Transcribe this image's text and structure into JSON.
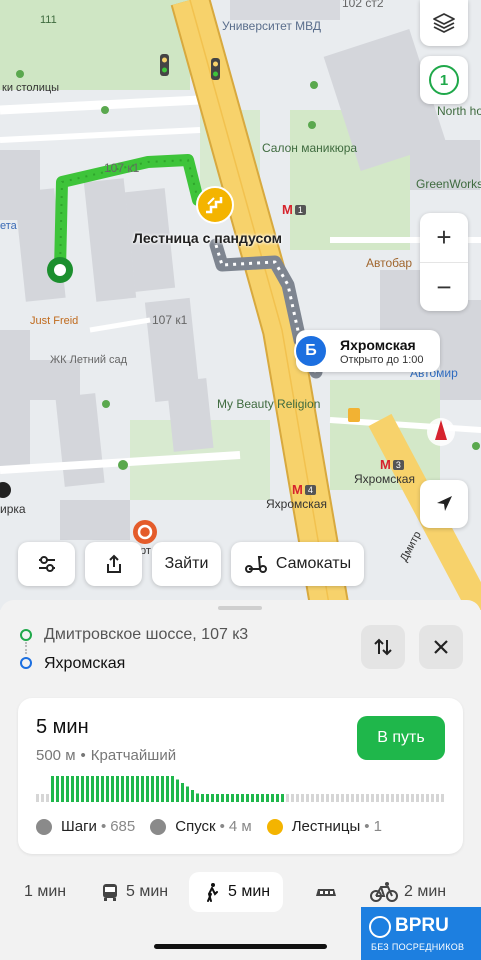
{
  "map": {
    "labels": {
      "university": "Университет МВД",
      "address_top": "102 ст2",
      "capital": "ки столицы",
      "north": "North ho",
      "nails": "Салон маникюра",
      "greenworks": "GreenWorks",
      "house_107k1_top": "107 к1",
      "house_107k1": "107 к1",
      "stairs": "Лестница с пандусом",
      "autobar": "Автобар",
      "just_freid": "Just Freid",
      "summer_garden": "ЖК Летний сад",
      "beauty": "My Beauty Religion",
      "yakhromskaya_1": "Яхромская",
      "yakhromskaya_2": "Яхромская",
      "automir": "Автомир",
      "left_edge": "ета",
      "rka": "ирка",
      "dmitrovskoe": "Дмитр",
      "num_111": "111",
      "sec_label": "рт"
    },
    "metro_lines": [
      "1",
      "3",
      "4"
    ],
    "destination": {
      "pin_letter": "Б",
      "name": "Яхромская",
      "hours": "Открыто до 1:00"
    },
    "route_counter": "1"
  },
  "chips": {
    "enter": "Зайти",
    "scooters": "Самокаты"
  },
  "route": {
    "from": "Дмитровское шоссе, 107 к3",
    "to": "Яхромская"
  },
  "summary": {
    "duration": "5 мин",
    "distance": "500 м",
    "separator": "•",
    "type": "Кратчайший",
    "go_button": "В путь",
    "steps_label": "Шаги",
    "steps_value": "685",
    "descent_label": "Спуск",
    "descent_value": "4 м",
    "stairs_label": "Лестницы",
    "stairs_value": "1"
  },
  "modes": {
    "car": "1 мин",
    "bus": "5 мин",
    "walk": "5 мин",
    "bike": "2 мин"
  },
  "watermark": {
    "brand": "BPRU",
    "tagline": "БЕЗ ПОСРЕДНИКОВ"
  },
  "colors": {
    "route_green": "#3ec43a",
    "go_button": "#1fb74b",
    "pin_blue": "#1c6fe0",
    "stairs_yellow": "#f4b400",
    "road": "#f7d26b"
  }
}
